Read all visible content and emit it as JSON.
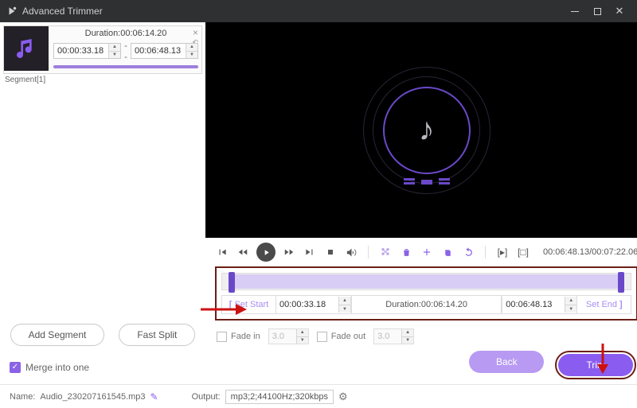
{
  "titlebar": {
    "title": "Advanced Trimmer"
  },
  "segment": {
    "label": "Segment[1]",
    "duration_label": "Duration:00:06:14.20",
    "start": "00:00:33.18",
    "end": "00:06:48.13"
  },
  "left_actions": {
    "add_segment": "Add Segment",
    "fast_split": "Fast Split",
    "merge_label": "Merge into one"
  },
  "playback": {
    "time_display": "00:06:48.13/00:07:22.06"
  },
  "range": {
    "set_start_label": "Set Start",
    "start": "00:00:33.18",
    "duration_label": "Duration:00:06:14.20",
    "end": "00:06:48.13",
    "set_end_label": "Set End"
  },
  "fade": {
    "in_label": "Fade in",
    "in_value": "3.0",
    "out_label": "Fade out",
    "out_value": "3.0"
  },
  "buttons": {
    "back": "Back",
    "trim": "Trim"
  },
  "footer": {
    "name_label": "Name:",
    "name_value": "Audio_230207161545.mp3",
    "output_label": "Output:",
    "output_value": "mp3;2;44100Hz;320kbps"
  }
}
